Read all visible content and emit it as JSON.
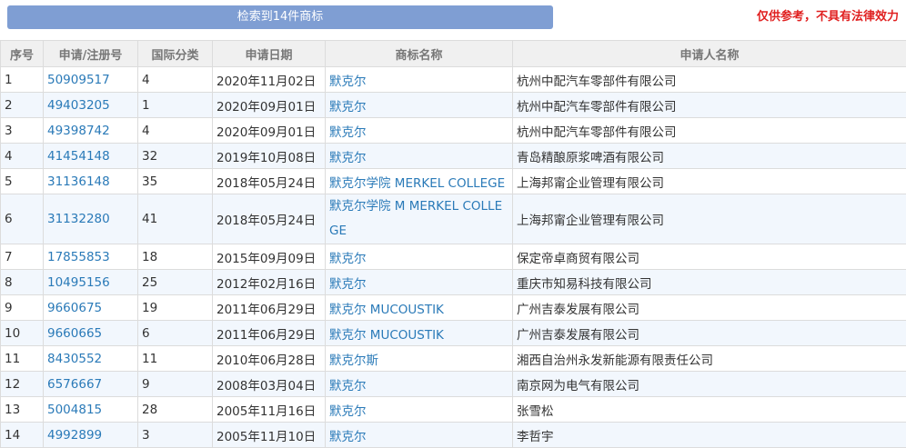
{
  "header": {
    "search_summary": "检索到14件商标",
    "disclaimer": "仅供参考，不具有法律效力"
  },
  "table": {
    "columns": {
      "index": "序号",
      "reg_no": "申请/注册号",
      "class": "国际分类",
      "date": "申请日期",
      "mark": "商标名称",
      "applicant": "申请人名称"
    },
    "rows": [
      {
        "index": "1",
        "reg_no": "50909517",
        "class": "4",
        "date": "2020年11月02日",
        "mark": "默克尔",
        "applicant": "杭州中配汽车零部件有限公司"
      },
      {
        "index": "2",
        "reg_no": "49403205",
        "class": "1",
        "date": "2020年09月01日",
        "mark": "默克尔",
        "applicant": "杭州中配汽车零部件有限公司"
      },
      {
        "index": "3",
        "reg_no": "49398742",
        "class": "4",
        "date": "2020年09月01日",
        "mark": "默克尔",
        "applicant": "杭州中配汽车零部件有限公司"
      },
      {
        "index": "4",
        "reg_no": "41454148",
        "class": "32",
        "date": "2019年10月08日",
        "mark": "默克尔",
        "applicant": "青岛精酿原浆啤酒有限公司"
      },
      {
        "index": "5",
        "reg_no": "31136148",
        "class": "35",
        "date": "2018年05月24日",
        "mark": "默克尔学院 MERKEL COLLEGE",
        "applicant": "上海邦甯企业管理有限公司"
      },
      {
        "index": "6",
        "reg_no": "31132280",
        "class": "41",
        "date": "2018年05月24日",
        "mark": "默克尔学院 M MERKEL COLLEGE",
        "applicant": "上海邦甯企业管理有限公司"
      },
      {
        "index": "7",
        "reg_no": "17855853",
        "class": "18",
        "date": "2015年09月09日",
        "mark": "默克尔",
        "applicant": "保定帝卓商贸有限公司"
      },
      {
        "index": "8",
        "reg_no": "10495156",
        "class": "25",
        "date": "2012年02月16日",
        "mark": "默克尔",
        "applicant": "重庆市知易科技有限公司"
      },
      {
        "index": "9",
        "reg_no": "9660675",
        "class": "19",
        "date": "2011年06月29日",
        "mark": "默克尔 MUCOUSTIK",
        "applicant": "广州吉泰发展有限公司"
      },
      {
        "index": "10",
        "reg_no": "9660665",
        "class": "6",
        "date": "2011年06月29日",
        "mark": "默克尔 MUCOUSTIK",
        "applicant": "广州吉泰发展有限公司"
      },
      {
        "index": "11",
        "reg_no": "8430552",
        "class": "11",
        "date": "2010年06月28日",
        "mark": "默克尔斯",
        "applicant": "湘西自治州永发新能源有限责任公司"
      },
      {
        "index": "12",
        "reg_no": "6576667",
        "class": "9",
        "date": "2008年03月04日",
        "mark": "默克尔",
        "applicant": "南京网为电气有限公司"
      },
      {
        "index": "13",
        "reg_no": "5004815",
        "class": "28",
        "date": "2005年11月16日",
        "mark": "默克尔",
        "applicant": "张雪松"
      },
      {
        "index": "14",
        "reg_no": "4992899",
        "class": "3",
        "date": "2005年11月10日",
        "mark": "默克尔",
        "applicant": "李哲宇"
      }
    ]
  }
}
